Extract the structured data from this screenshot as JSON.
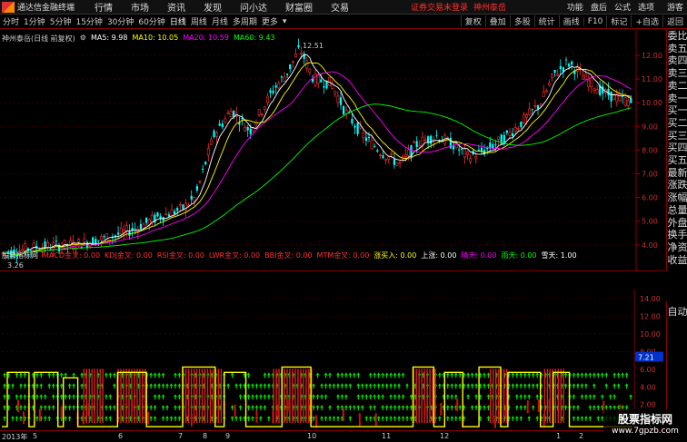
{
  "titlebar": {
    "app_name": "通达信金融终端",
    "menu": [
      "行情",
      "市场",
      "资讯",
      "发现",
      "问小达",
      "财富圈",
      "交易"
    ],
    "notice": "证券交易未登录",
    "stock": "神州泰岳",
    "right_menu": [
      "功能",
      "盘后",
      "公式",
      "选项"
    ],
    "guest": "游客"
  },
  "toolbar": {
    "timeframes": [
      "分时",
      "1分钟",
      "5分钟",
      "15分钟",
      "30分钟",
      "60分钟",
      "日线",
      "周线",
      "月线",
      "多周期",
      "更多"
    ],
    "selected": "日线",
    "right_buttons": [
      "复权",
      "叠加",
      "多股",
      "统计",
      "画线",
      "F10",
      "标记",
      "+自选",
      "返回"
    ]
  },
  "main_info": {
    "title": "神州泰岳(日线 前复权)",
    "ma5": "MA5: 9.98",
    "ma10": "MA10: 10.05",
    "ma20": "MA20: 10.59",
    "ma60": "MA60: 9.43",
    "colors": {
      "ma5": "#ffffff",
      "ma10": "#ffff00",
      "ma20": "#ff00ff",
      "ma60": "#00ff00"
    }
  },
  "price_labels": [
    "12.00",
    "11.00",
    "10.00",
    "9.00",
    "8.00",
    "7.00",
    "6.00",
    "5.00",
    "4.00"
  ],
  "high_label": "12.51",
  "low_label": "3.26",
  "right_panel": [
    "委比",
    "卖五",
    "卖四",
    "卖三",
    "卖二",
    "卖一",
    "买一",
    "买二",
    "买三",
    "买四",
    "买五",
    "最新",
    "涨跌",
    "涨幅",
    "总量",
    "外盘",
    "换手",
    "净资",
    "收益"
  ],
  "sub_info": {
    "title": "股票指标网",
    "items": [
      {
        "text": "MACD金叉: 0.00",
        "color": "#ff3030"
      },
      {
        "text": "KDJ金叉: 0.00",
        "color": "#ff3030"
      },
      {
        "text": "RSI金叉: 0.00",
        "color": "#ff3030"
      },
      {
        "text": "LWR金叉: 0.00",
        "color": "#ff3030"
      },
      {
        "text": "BBI金叉: 0.00",
        "color": "#ff3030"
      },
      {
        "text": "MTM金叉: 0.00",
        "color": "#ff3030"
      },
      {
        "text": "涨买入: 0.00",
        "color": "#ffff00"
      },
      {
        "text": "上涨: 0.00",
        "color": "#ffffff"
      },
      {
        "text": "晴天: 0.00",
        "color": "#ff00ff"
      },
      {
        "text": "雨天: 0.00",
        "color": "#00ff00"
      },
      {
        "text": "雪天: 1.00",
        "color": "#ffffff"
      }
    ]
  },
  "sub_labels": [
    "14.00",
    "12.00",
    "10.00",
    "8.00",
    "6.00",
    "4.00",
    "2.00"
  ],
  "sub_current": "7.21",
  "sub_right_label": "自动",
  "xaxis": [
    {
      "label": "2013年",
      "pos": 2
    },
    {
      "label": "5",
      "pos": 36
    },
    {
      "label": "6",
      "pos": 130
    },
    {
      "label": "7",
      "pos": 196
    },
    {
      "label": "8",
      "pos": 223
    },
    {
      "label": "9",
      "pos": 248
    },
    {
      "label": "10",
      "pos": 338
    },
    {
      "label": "11",
      "pos": 420
    },
    {
      "label": "12",
      "pos": 484
    },
    {
      "label": "1",
      "pos": 612
    },
    {
      "label": "2",
      "pos": 637
    }
  ],
  "watermark": {
    "line1": "股票指标网",
    "line2": "www.7gpzb.com"
  }
}
